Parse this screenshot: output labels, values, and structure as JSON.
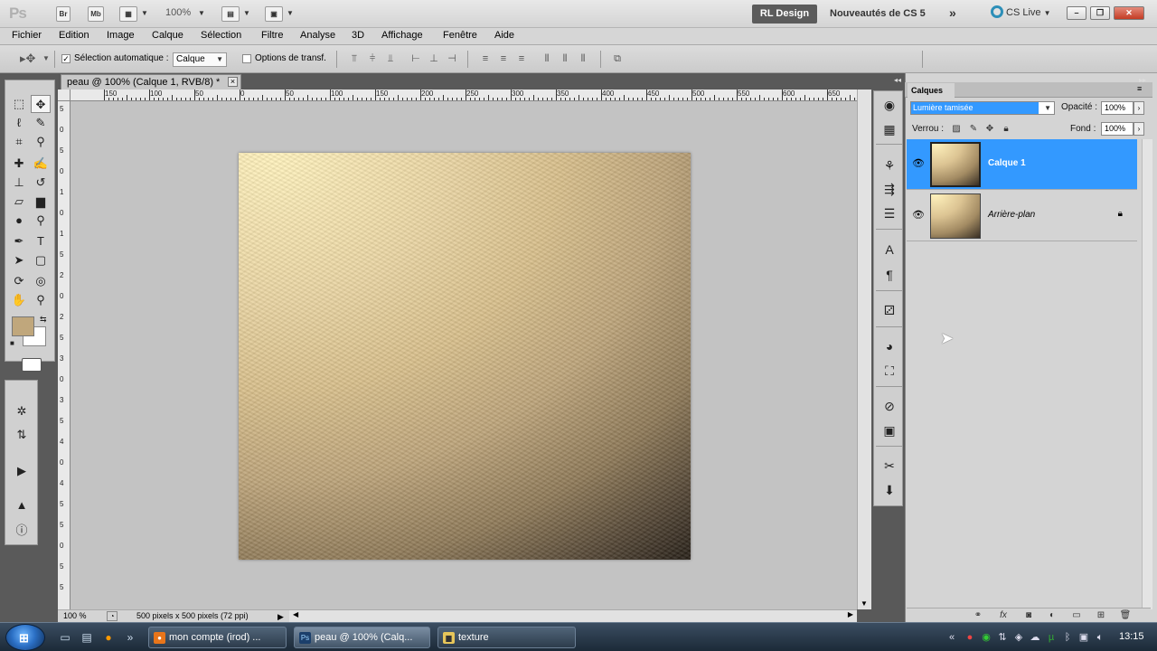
{
  "appbar": {
    "logo": "Ps",
    "bridge_label": "Br",
    "minibridge_label": "Mb",
    "zoom_value": "100%",
    "workspace_button": "RL Design",
    "workspace_new": "Nouveautés de CS 5",
    "more_symbol": "»",
    "cslive_label": "CS Live",
    "window_buttons": [
      "–",
      "❐",
      "✕"
    ]
  },
  "menu": {
    "items": [
      "Fichier",
      "Edition",
      "Image",
      "Calque",
      "Sélection",
      "Filtre",
      "Analyse",
      "3D",
      "Affichage",
      "Fenêtre",
      "Aide"
    ]
  },
  "options": {
    "auto_select_label": "Sélection automatique :",
    "auto_select_checked": "✓",
    "auto_select_value": "Calque",
    "transform_label": "Options de transf."
  },
  "document": {
    "tab_title": "peau @ 100% (Calque 1, RVB/8) *",
    "close": "×",
    "ruler_h_labels": [
      "150",
      "100",
      "50",
      "0",
      "50",
      "100",
      "150",
      "200",
      "250",
      "300",
      "350",
      "400",
      "450",
      "500",
      "550",
      "600",
      "650"
    ],
    "ruler_v_labels": [
      "5",
      "0",
      "5",
      "0",
      "1",
      "0",
      "1",
      "5",
      "2",
      "0",
      "2",
      "5",
      "3",
      "0",
      "3",
      "5",
      "4",
      "0",
      "4",
      "5",
      "5",
      "0",
      "5",
      "5"
    ],
    "zoom_status": "100 %",
    "doc_info": "500 pixels x 500 pixels (72 ppi)"
  },
  "layers_panel": {
    "tab_label": "Calques",
    "blend_mode": "Lumière tamisée",
    "opacity_label": "Opacité :",
    "opacity_value": "100%",
    "lock_label": "Verrou :",
    "fill_label": "Fond :",
    "fill_value": "100%",
    "layers": [
      {
        "name": "Calque 1",
        "selected": true
      },
      {
        "name": "Arrière-plan",
        "selected": false,
        "locked": true
      }
    ]
  },
  "colors": {
    "foreground": "#c0a77c",
    "background": "#ffffff",
    "selection_blue": "#3399ff"
  },
  "taskbar": {
    "tasks": [
      "mon compte (irod) ...",
      "peau @ 100% (Calq...",
      "texture"
    ],
    "clock": "13:15"
  }
}
